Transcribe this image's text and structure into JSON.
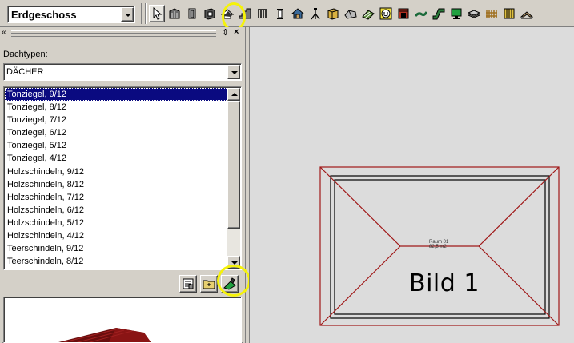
{
  "toolbar": {
    "floor_selector": {
      "value": "Erdgeschoss"
    },
    "tools": [
      {
        "name": "select-arrow-icon"
      },
      {
        "name": "wall-icon"
      },
      {
        "name": "door-icon"
      },
      {
        "name": "window-icon"
      },
      {
        "name": "roof-tool-icon",
        "highlighted": true
      },
      {
        "name": "stairs-icon"
      },
      {
        "name": "railing-icon"
      },
      {
        "name": "column-icon"
      },
      {
        "name": "house-icon"
      },
      {
        "name": "tripod-icon"
      },
      {
        "name": "cabinet-icon"
      },
      {
        "name": "roof-shape-icon"
      },
      {
        "name": "terrain-icon"
      },
      {
        "name": "face-icon"
      },
      {
        "name": "fireplace-icon"
      },
      {
        "name": "pipe-icon"
      },
      {
        "name": "ramp-icon"
      },
      {
        "name": "monitor-icon"
      },
      {
        "name": "layers-icon"
      },
      {
        "name": "fence-icon"
      },
      {
        "name": "gate-icon"
      },
      {
        "name": "slope-icon"
      }
    ]
  },
  "panel": {
    "roof_types_label": "Dachtypen:",
    "category": {
      "value": "DÄCHER"
    },
    "items": [
      "Tonziegel, 9/12",
      "Tonziegel, 8/12",
      "Tonziegel, 7/12",
      "Tonziegel, 6/12",
      "Tonziegel, 5/12",
      "Tonziegel, 4/12",
      "Holzschindeln, 9/12",
      "Holzschindeln, 8/12",
      "Holzschindeln, 7/12",
      "Holzschindeln, 6/12",
      "Holzschindeln, 5/12",
      "Holzschindeln, 4/12",
      "Teerschindeln, 9/12",
      "Teerschindeln, 8/12"
    ],
    "selected_index": 0,
    "list_buttons": [
      {
        "name": "properties-icon"
      },
      {
        "name": "new-folder-icon"
      },
      {
        "name": "apply-roof-icon",
        "highlighted": true
      }
    ]
  },
  "canvas": {
    "room_label_line1": "Raum 01",
    "room_label_line2": "82,5 m2",
    "caption": "Bild 1"
  },
  "colors": {
    "selection": "#0a0a80",
    "highlight": "#f5f20a",
    "roof_outline": "#a01818",
    "wall_outline": "#000000"
  }
}
